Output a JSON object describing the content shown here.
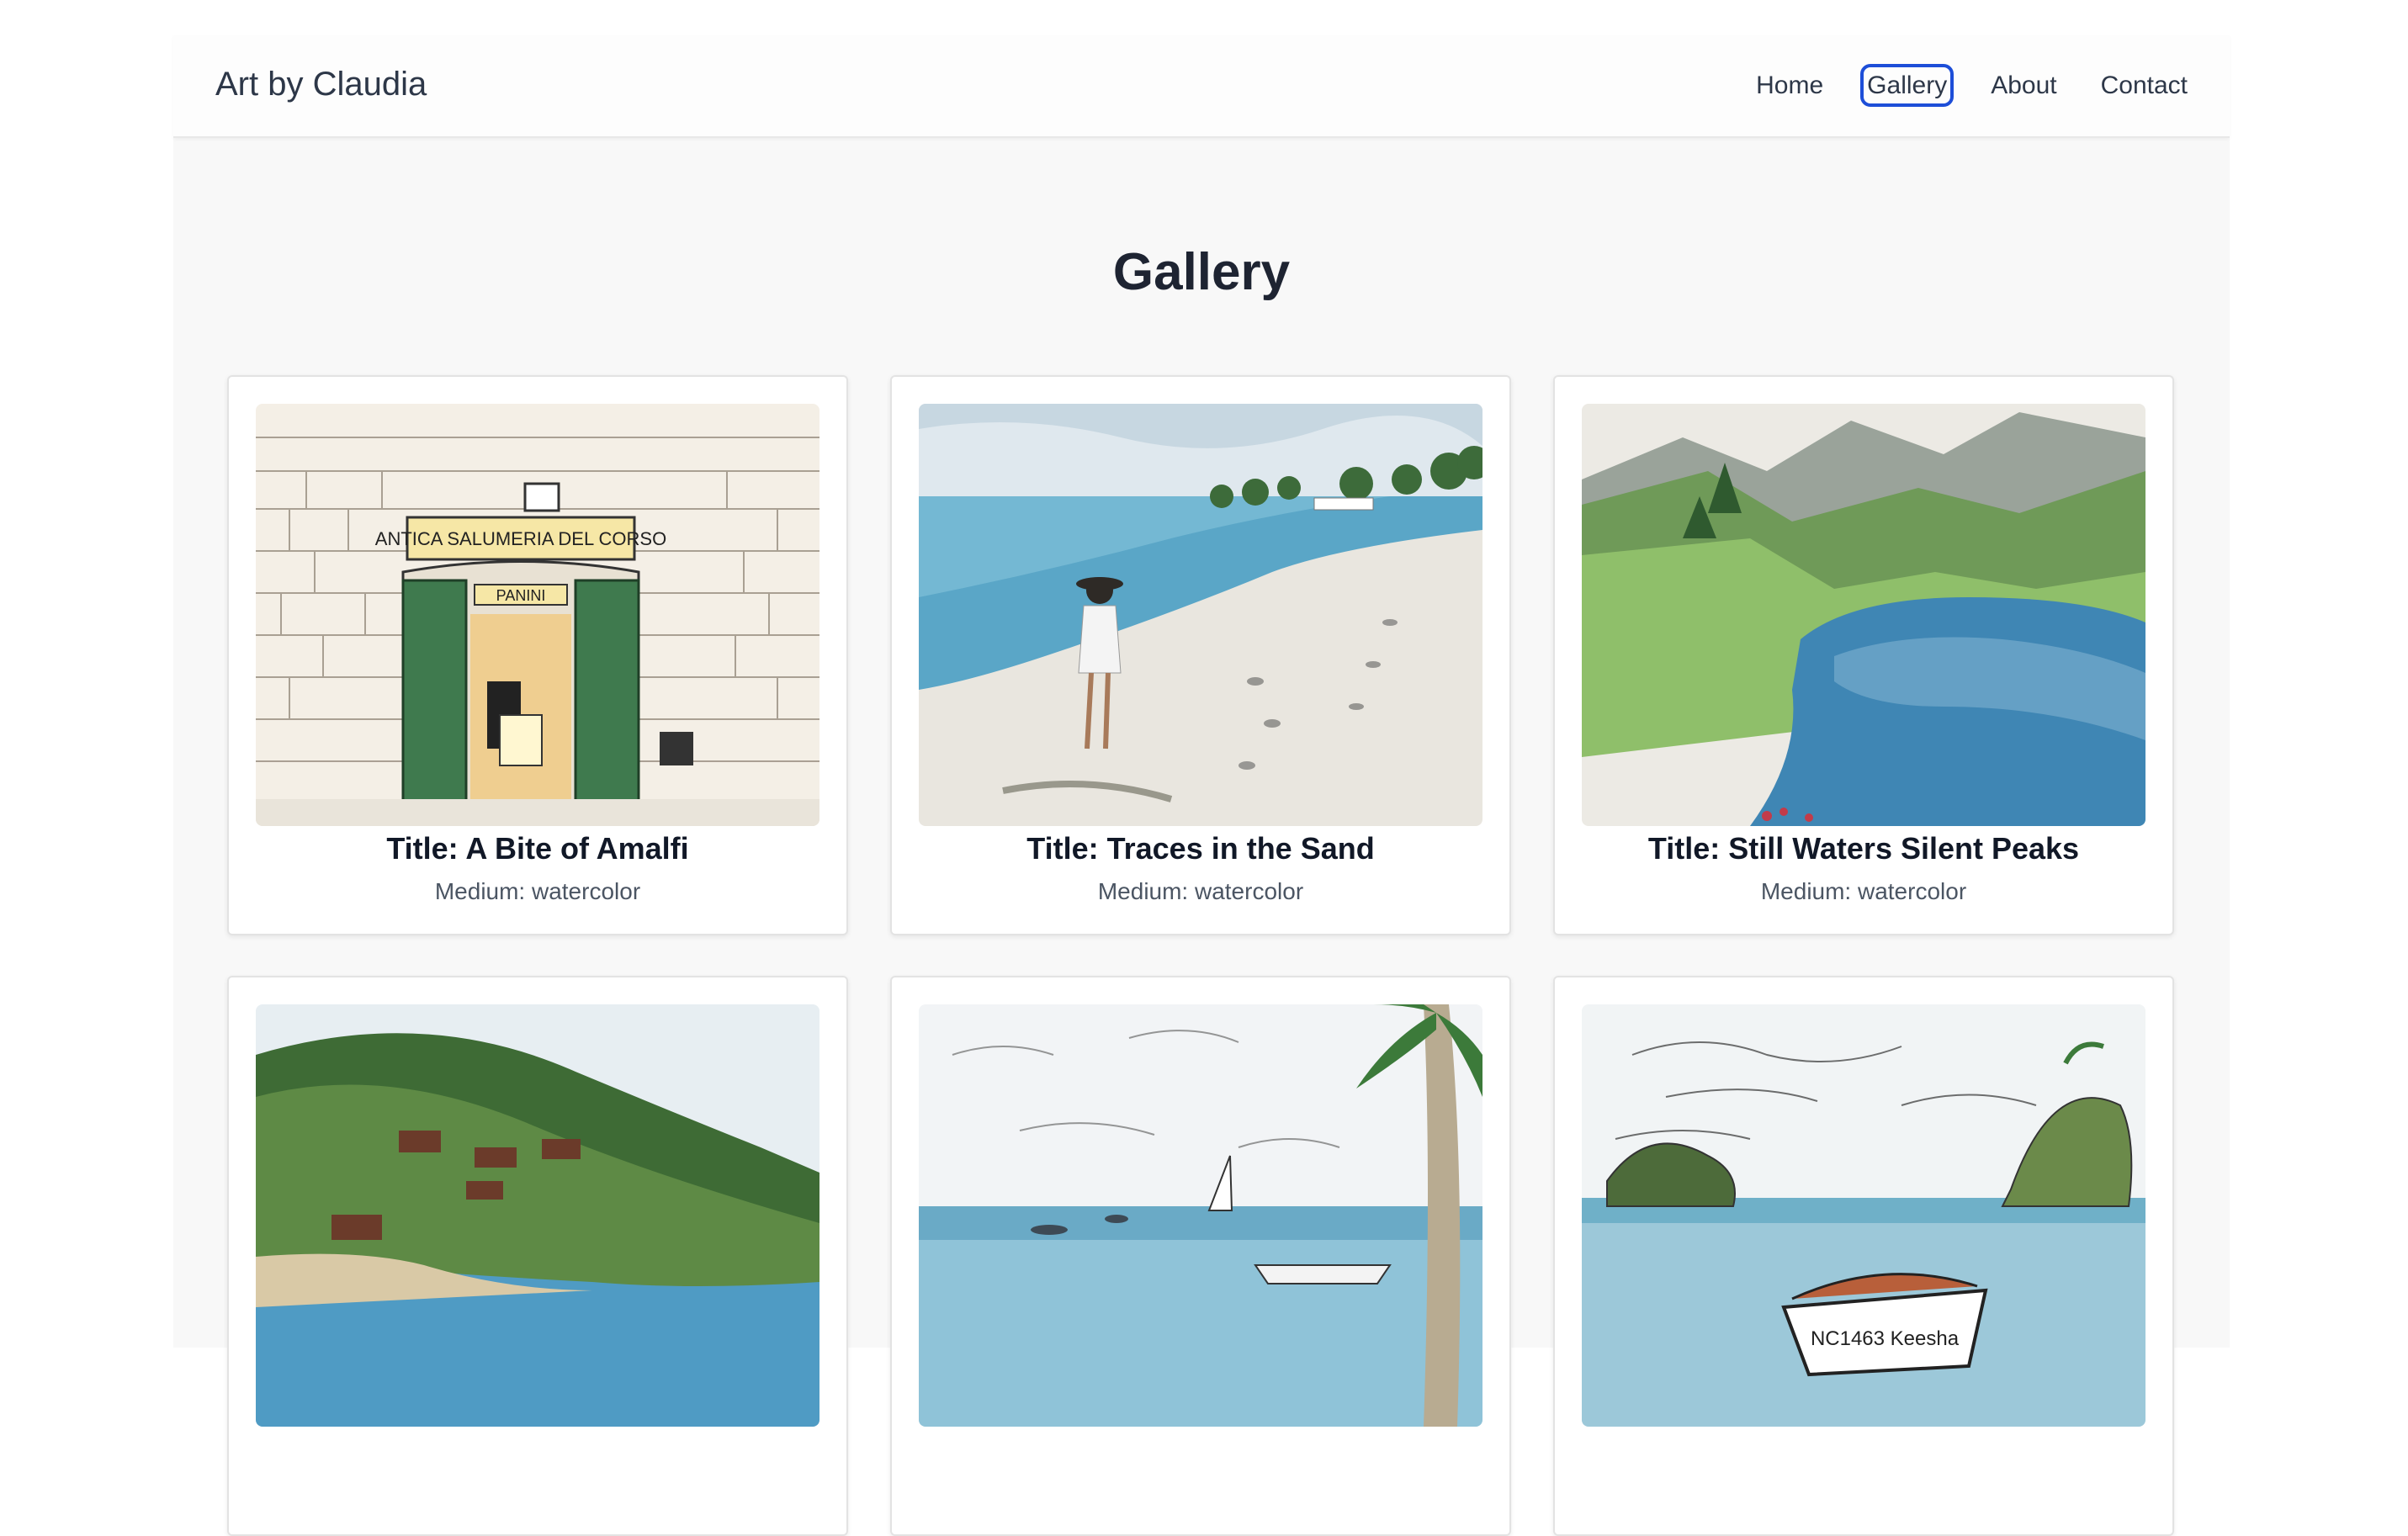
{
  "nav": {
    "brand": "Art by Claudia",
    "links": [
      "Home",
      "Gallery",
      "About",
      "Contact"
    ],
    "active": "Gallery"
  },
  "main": {
    "heading": "Gallery"
  },
  "gallery": [
    {
      "title": "Title: A Bite of Amalfi",
      "medium": "Medium: watercolor",
      "sign_text": "ANTICA SALUMERIA DEL CORSO",
      "door_text": "PANINI"
    },
    {
      "title": "Title: Traces in the Sand",
      "medium": "Medium: watercolor"
    },
    {
      "title": "Title: Still Waters Silent Peaks",
      "medium": "Medium: watercolor"
    },
    {
      "title": "",
      "medium": ""
    },
    {
      "title": "",
      "medium": ""
    },
    {
      "title": "",
      "medium": "",
      "boat_text": "NC1463 Keesha"
    }
  ],
  "colors": {
    "accent_outline": "#1d4ed8",
    "door_green": "#3f7a4e",
    "water_blue": "#4a90b8"
  }
}
